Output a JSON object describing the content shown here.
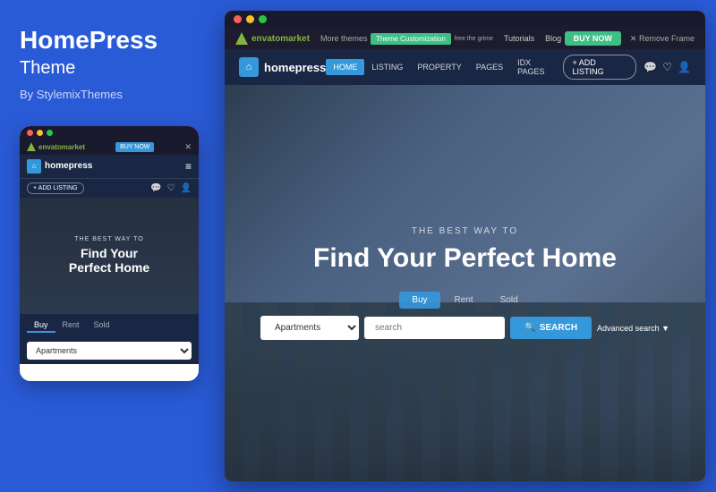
{
  "left": {
    "title": "HomePress",
    "subtitle": "Theme",
    "author": "By StylemixThemes"
  },
  "mobile": {
    "dots": [
      "red",
      "yellow",
      "green"
    ],
    "envato_text": "envatomarket",
    "buy_now": "BUY NOW",
    "close_x": "✕",
    "logo_text": "homepress",
    "hamburger": "≡",
    "add_listing": "+ ADD LISTING",
    "hero_sub": "THE BEST WAY TO",
    "hero_title_line1": "Find Your",
    "hero_title_line2": "Perfect Home",
    "tabs": [
      "Buy",
      "Rent",
      "Sold"
    ],
    "active_tab": "Buy",
    "search_placeholder": "Apartments"
  },
  "desktop": {
    "envato_text": "envatomarket",
    "more_themes": "More themes",
    "theme_customization": "Theme Customization",
    "theme_cust_sub": "free the grime",
    "tutorials": "Tutorials",
    "blog": "Blog",
    "buy_now": "BUY NOW",
    "remove_frame": "✕ Remove Frame",
    "logo_text": "homepress",
    "nav_links": [
      "HOME",
      "LISTING",
      "PROPERTY",
      "PAGES",
      "IDX PAGES"
    ],
    "active_nav": "HOME",
    "add_listing": "+ ADD LISTING",
    "hero_sub": "THE BEST WAY TO",
    "hero_title": "Find Your Perfect Home",
    "search_tabs": [
      "Buy",
      "Rent",
      "Sold"
    ],
    "active_search_tab": "Buy",
    "search_placeholder": "search",
    "property_type": "Apartments",
    "search_btn": "SEARCH",
    "advanced_search": "Advanced search ▼"
  }
}
